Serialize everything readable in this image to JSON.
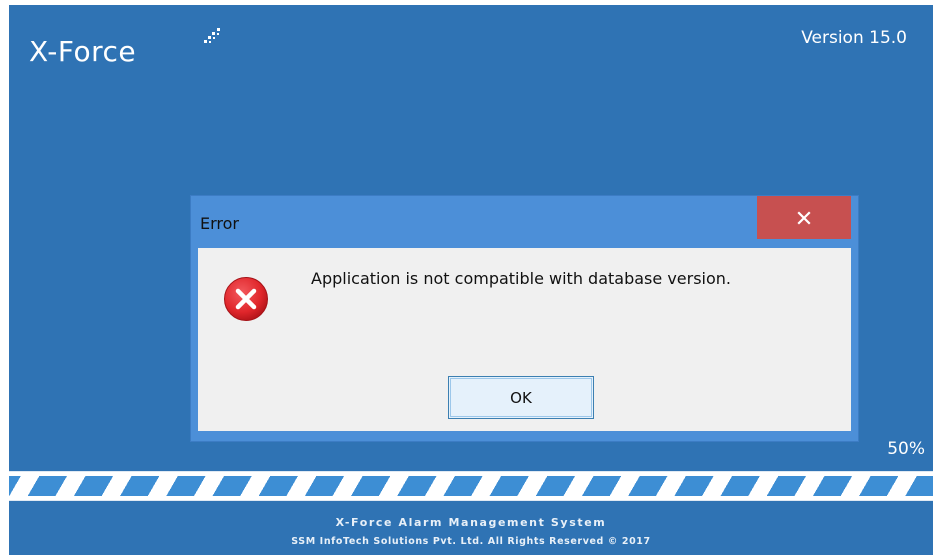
{
  "splash": {
    "app_title": "X-Force",
    "logo_icon": "sparkle-dots-icon",
    "version": "Version 15.0",
    "progress_percent_label": "50%",
    "progress_value": 1.0,
    "footer_line1": "X-Force Alarm Management System",
    "footer_line2": "SSM InfoTech Solutions Pvt. Ltd. All Rights Reserved © 2017",
    "colors": {
      "background": "#2f73b4",
      "progress_stripe": "#3d8ed4"
    }
  },
  "dialog": {
    "title": "Error",
    "close_icon": "close-icon",
    "error_icon": "error-x-icon",
    "message": "Application is not compatible with database version.",
    "ok_label": "OK",
    "colors": {
      "frame": "#4c8fd8",
      "close_button": "#c75050",
      "error_icon": "#e0262b"
    }
  }
}
